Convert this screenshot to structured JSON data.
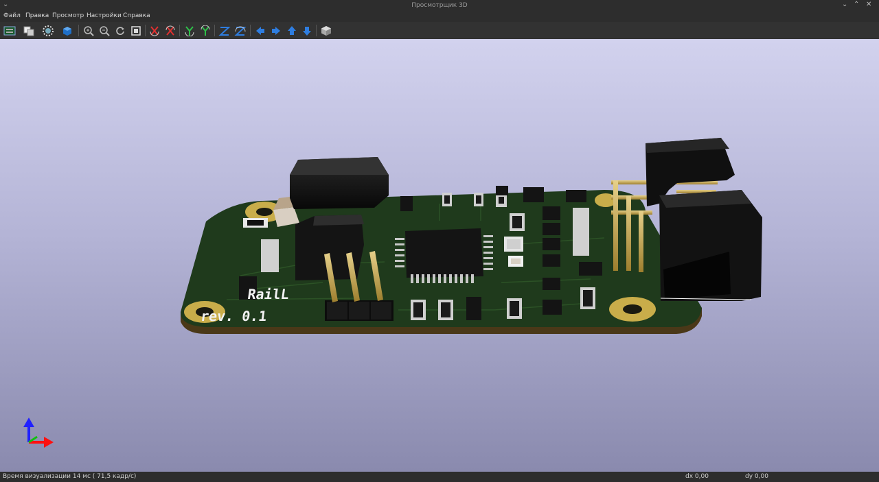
{
  "window": {
    "title": "Просмотрщик 3D"
  },
  "menu": {
    "items": [
      "Файл",
      "Правка",
      "Просмотр",
      "Настройки",
      "Справка"
    ]
  },
  "toolbar": {
    "icons": [
      "reload-board-icon",
      "copy-image-icon",
      "render-options-icon",
      "raytracing-icon",
      "zoom-in-icon",
      "zoom-out-icon",
      "redraw-icon",
      "zoom-fit-icon",
      "rotate-x-cw-icon",
      "rotate-x-ccw-icon",
      "rotate-y-cw-icon",
      "rotate-y-ccw-icon",
      "rotate-z-cw-icon",
      "rotate-z-ccw-icon",
      "move-left-icon",
      "move-right-icon",
      "move-up-icon",
      "move-down-icon",
      "ortho-view-icon"
    ]
  },
  "board": {
    "silkscreen_name": "RailL",
    "silkscreen_rev": "rev. 0.1"
  },
  "status": {
    "render_time": "Время визуализации 14 мс ( 71,5 кадр/с)",
    "dx": "dx 0,00",
    "dy": "dy 0,00"
  },
  "colors": {
    "pcb": "#1f3a1c",
    "pad_gold": "#c9ad4a",
    "chrome_bg": "#2d2d2d",
    "accent_blue": "#2e7de0"
  }
}
